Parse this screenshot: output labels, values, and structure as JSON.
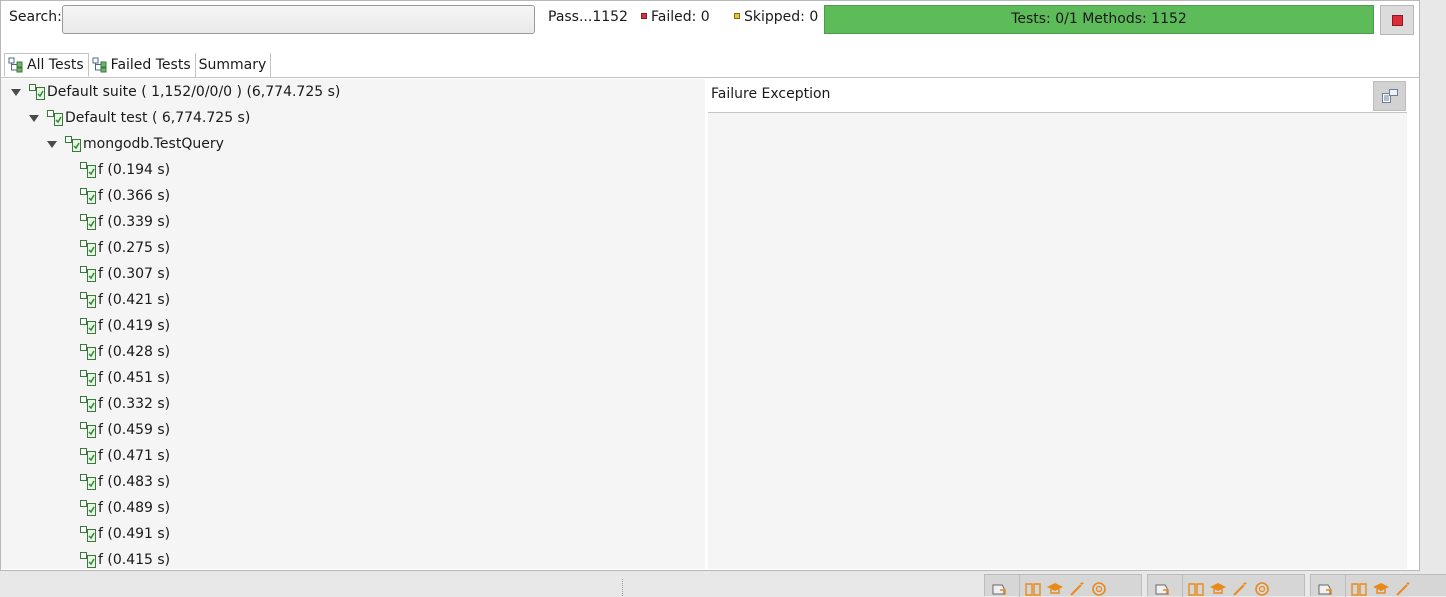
{
  "search": {
    "label": "Search:",
    "value": "",
    "placeholder": ""
  },
  "counters": {
    "passed": "Pass...1152",
    "failed": "Failed: 0",
    "skipped": "Skipped: 0"
  },
  "progress": {
    "text": "Tests: 0/1  Methods: 1152",
    "fraction": 1.0,
    "color": "#5dbb5a"
  },
  "tabs": [
    {
      "label": "All Tests",
      "icon": "tests-tree-icon",
      "active": true
    },
    {
      "label": "Failed Tests",
      "icon": "tests-tree-icon",
      "active": false
    },
    {
      "label": "Summary",
      "icon": "",
      "active": false
    }
  ],
  "tree": {
    "suite": "Default suite ( 1,152/0/0/0 ) (6,774.725 s)",
    "test": "Default test ( 6,774.725 s)",
    "class": "mongodb.TestQuery",
    "methods": [
      "f  (0.194 s)",
      "f  (0.366 s)",
      "f  (0.339 s)",
      "f  (0.275 s)",
      "f  (0.307 s)",
      "f  (0.421 s)",
      "f  (0.419 s)",
      "f  (0.428 s)",
      "f  (0.451 s)",
      "f  (0.332 s)",
      "f  (0.459 s)",
      "f  (0.471 s)",
      "f  (0.483 s)",
      "f  (0.489 s)",
      "f  (0.491 s)",
      "f  (0.415 s)"
    ]
  },
  "failure_panel": {
    "title": "Failure Exception"
  },
  "colors": {
    "pass": "#5dbb5a",
    "fail": "#d9333f",
    "skip": "#e9c43a",
    "accent_icon": "#e88a1a"
  }
}
